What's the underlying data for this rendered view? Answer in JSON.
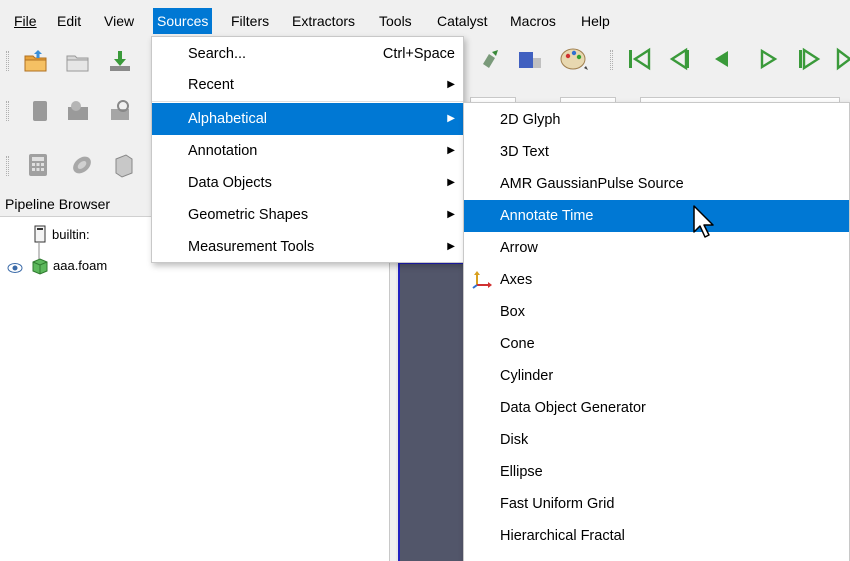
{
  "menubar": {
    "items": [
      {
        "label": "File"
      },
      {
        "label": "Edit"
      },
      {
        "label": "View"
      },
      {
        "label": "Sources"
      },
      {
        "label": "Filters"
      },
      {
        "label": "Extractors"
      },
      {
        "label": "Tools"
      },
      {
        "label": "Catalyst"
      },
      {
        "label": "Macros"
      },
      {
        "label": "Help"
      }
    ]
  },
  "sources_menu": {
    "items": [
      {
        "label": "Search...",
        "shortcut": "Ctrl+Space"
      },
      {
        "label": "Recent"
      },
      {
        "label": "Alphabetical"
      },
      {
        "label": "Annotation"
      },
      {
        "label": "Data Objects"
      },
      {
        "label": "Geometric Shapes"
      },
      {
        "label": "Measurement Tools"
      }
    ]
  },
  "alphabetical_menu": {
    "items": [
      {
        "label": "2D Glyph"
      },
      {
        "label": "3D Text"
      },
      {
        "label": "AMR GaussianPulse Source"
      },
      {
        "label": "Annotate Time"
      },
      {
        "label": "Arrow"
      },
      {
        "label": "Axes"
      },
      {
        "label": "Box"
      },
      {
        "label": "Cone"
      },
      {
        "label": "Cylinder"
      },
      {
        "label": "Data Object Generator"
      },
      {
        "label": "Disk"
      },
      {
        "label": "Ellipse"
      },
      {
        "label": "Fast Uniform Grid"
      },
      {
        "label": "Hierarchical Fractal"
      }
    ]
  },
  "pipeline": {
    "header": "Pipeline Browser",
    "items": [
      {
        "label": "builtin:"
      },
      {
        "label": "aaa.foam"
      }
    ]
  },
  "colors": {
    "highlight": "#0078d4",
    "view_background": "#52566a",
    "view_border": "#2020c0"
  }
}
